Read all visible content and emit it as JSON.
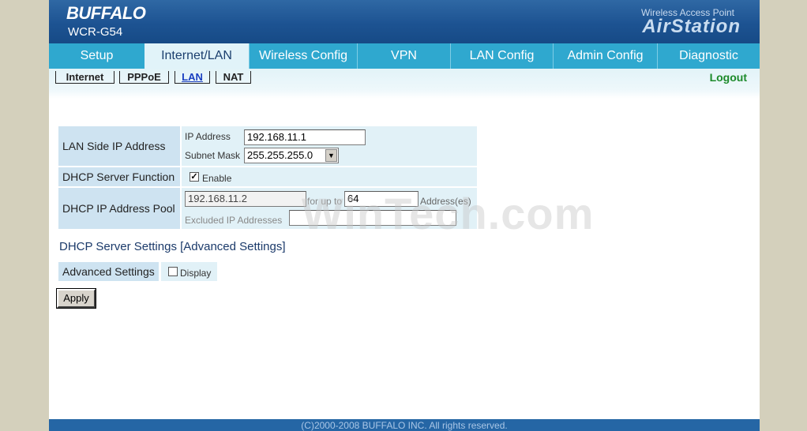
{
  "header": {
    "brand": "BUFFALO",
    "model": "WCR-G54",
    "product_line": "Wireless Access Point",
    "product_name": "AirStation"
  },
  "nav": {
    "tabs": [
      {
        "label": "Setup"
      },
      {
        "label": "Internet/LAN",
        "active": true
      },
      {
        "label": "Wireless Config"
      },
      {
        "label": "VPN"
      },
      {
        "label": "LAN Config"
      },
      {
        "label": "Admin Config"
      },
      {
        "label": "Diagnostic"
      }
    ]
  },
  "subnav": {
    "items": [
      {
        "label": "Internet"
      },
      {
        "label": "PPPoE"
      },
      {
        "label": "LAN",
        "active": true
      },
      {
        "label": "NAT"
      }
    ],
    "logout": "Logout"
  },
  "lan_ip": {
    "label": "LAN Side IP Address",
    "ip_label": "IP Address",
    "ip_value": "192.168.11.1",
    "mask_label": "Subnet Mask",
    "mask_value": "255.255.255.0"
  },
  "dhcp_function": {
    "label": "DHCP Server Function",
    "checked": true,
    "enable_label": "Enable"
  },
  "dhcp_pool": {
    "label": "DHCP IP Address Pool",
    "start_value": "192.168.11.2",
    "for_up_to": "for up to",
    "count_value": "64",
    "addresses_label": "Address(es)",
    "excluded_label": "Excluded IP Addresses",
    "excluded_value": ""
  },
  "advanced": {
    "section_title": "DHCP Server Settings [Advanced Settings]",
    "label": "Advanced Settings",
    "checked": false,
    "display_label": "Display"
  },
  "apply_label": "Apply",
  "watermark": "WinTech.com",
  "footer": "(C)2000-2008 BUFFALO INC. All rights reserved.",
  "colors": {
    "header_blue": "#1d5392",
    "nav_cyan": "#2fa8cf",
    "label_cell": "#cee3f1",
    "value_cell": "#e1f1f7",
    "logout_green": "#1c8a2a",
    "footer_blue": "#2566a5"
  }
}
